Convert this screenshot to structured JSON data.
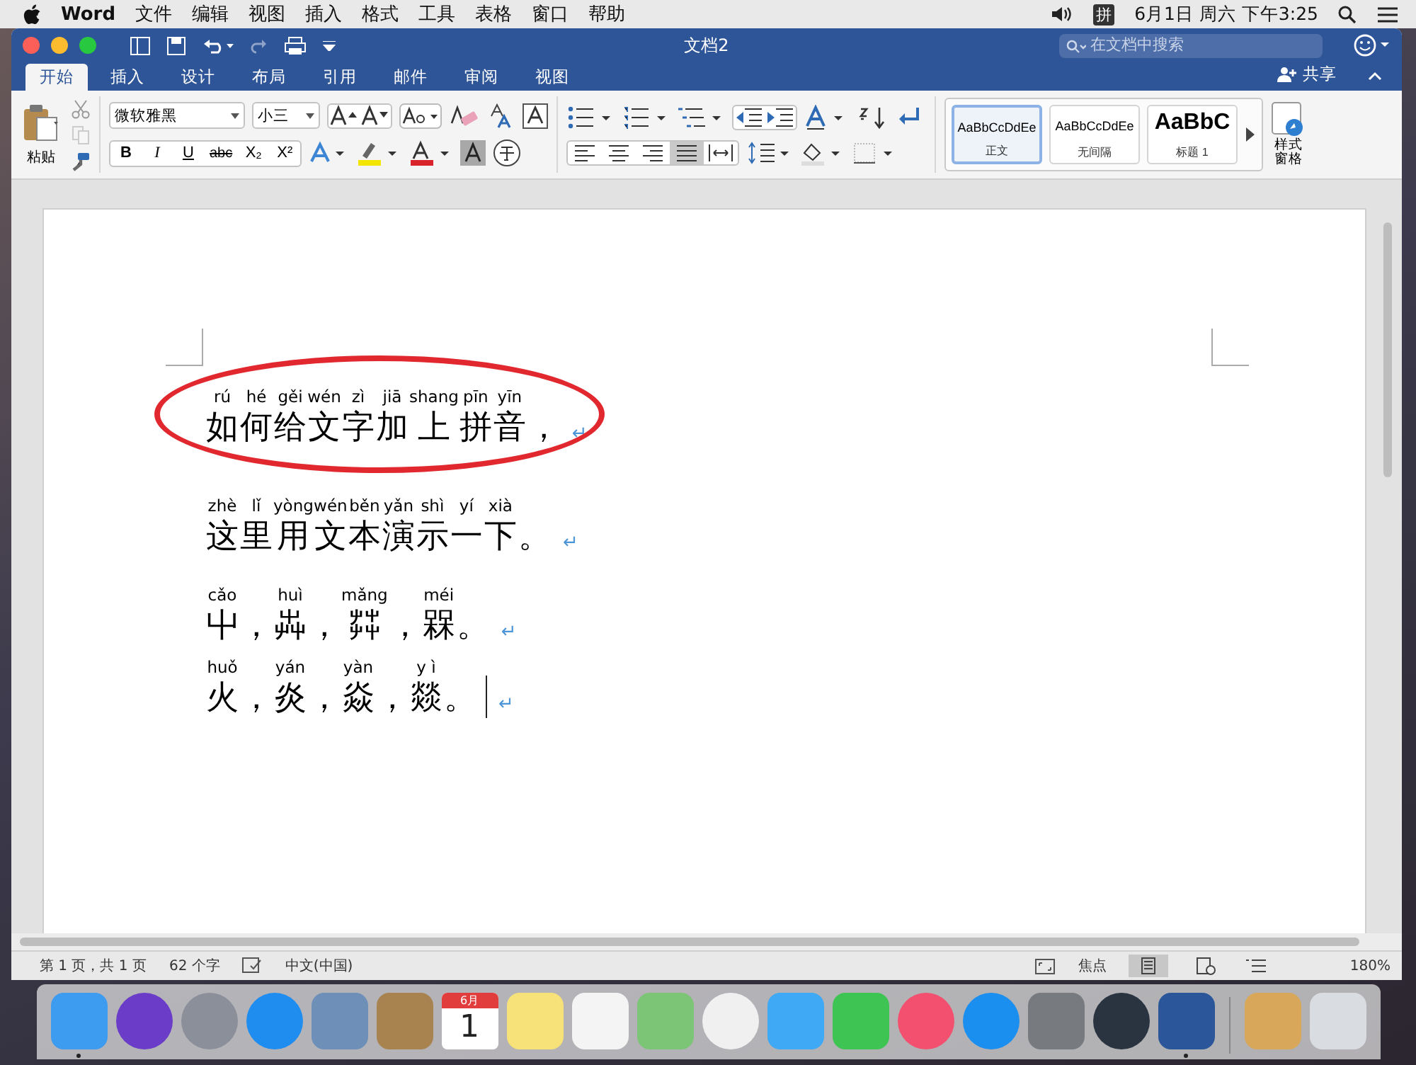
{
  "menu_bar": {
    "app": "Word",
    "menus": [
      "文件",
      "编辑",
      "视图",
      "插入",
      "格式",
      "工具",
      "表格",
      "窗口",
      "帮助"
    ],
    "input_method": "拼",
    "clock": "6月1日 周六 下午3:25"
  },
  "window": {
    "title": "文档2",
    "search": {
      "placeholder": "在文档中搜索"
    }
  },
  "tabs": [
    {
      "label": "开始",
      "selected": true
    },
    {
      "label": "插入",
      "selected": false
    },
    {
      "label": "设计",
      "selected": false
    },
    {
      "label": "布局",
      "selected": false
    },
    {
      "label": "引用",
      "selected": false
    },
    {
      "label": "邮件",
      "selected": false
    },
    {
      "label": "审阅",
      "selected": false
    },
    {
      "label": "视图",
      "selected": false
    }
  ],
  "share": "共享",
  "ribbon": {
    "paste": "粘贴",
    "font": "微软雅黑",
    "size": "小三",
    "format_buttons": [
      "B",
      "I",
      "U",
      "abc",
      "X₂",
      "X²"
    ],
    "styles": [
      {
        "sample": "AaBbCcDdEe",
        "name": "正文",
        "kind": "normal",
        "selected": true
      },
      {
        "sample": "AaBbCcDdEe",
        "name": "无间隔",
        "kind": "normal",
        "selected": false
      },
      {
        "sample": "AaBbC",
        "name": "标题 1",
        "kind": "heading",
        "selected": false
      }
    ],
    "styles_pane": [
      "样式",
      "窗格"
    ]
  },
  "document": {
    "lines": [
      {
        "circled": true,
        "mark": "↵",
        "segments": [
          {
            "pinyin": "rú",
            "text": "如"
          },
          {
            "pinyin": "hé",
            "text": "何"
          },
          {
            "pinyin": "gěi",
            "text": "给"
          },
          {
            "pinyin": "wén",
            "text": "文"
          },
          {
            "pinyin": "zì",
            "text": "字"
          },
          {
            "pinyin": "jiā",
            "text": "加"
          },
          {
            "pinyin": "shang",
            "text": "上"
          },
          {
            "pinyin": "pīn",
            "text": "拼"
          },
          {
            "pinyin": "yīn",
            "text": "音"
          },
          {
            "text": "，"
          }
        ]
      },
      {
        "circled": false,
        "mark": "↵",
        "segments": [
          {
            "pinyin": "zhè",
            "text": "这"
          },
          {
            "pinyin": "lǐ",
            "text": "里"
          },
          {
            "pinyin": "yòng",
            "text": "用"
          },
          {
            "pinyin": "wén",
            "text": "文"
          },
          {
            "pinyin": "běn",
            "text": "本"
          },
          {
            "pinyin": "yǎn",
            "text": "演"
          },
          {
            "pinyin": "shì",
            "text": "示"
          },
          {
            "pinyin": "yí",
            "text": "一"
          },
          {
            "pinyin": "xià",
            "text": "下"
          },
          {
            "text": "。"
          }
        ]
      },
      {
        "circled": false,
        "mark": "↵",
        "segments": [
          {
            "pinyin": "cǎo",
            "text": "屮"
          },
          {
            "text": "，"
          },
          {
            "pinyin": "huì",
            "text": "芔"
          },
          {
            "text": "，"
          },
          {
            "pinyin": "mǎng",
            "text": "茻"
          },
          {
            "text": "，"
          },
          {
            "pinyin": "méi",
            "text": "槑"
          },
          {
            "text": "。"
          }
        ]
      },
      {
        "circled": false,
        "mark": "↵",
        "cursor": true,
        "segments": [
          {
            "pinyin": "huǒ",
            "text": "火"
          },
          {
            "text": "，"
          },
          {
            "pinyin": "yán",
            "text": "炎"
          },
          {
            "text": "，"
          },
          {
            "pinyin": "yàn",
            "text": "焱"
          },
          {
            "text": "，"
          },
          {
            "pinyin": "y ì",
            "text": "燚"
          },
          {
            "text": "。"
          }
        ]
      }
    ]
  },
  "status_bar": {
    "page": "第 1 页，共 1 页",
    "words": "62 个字",
    "language": "中文(中国)",
    "focus": "焦点",
    "zoom": "180%"
  },
  "dock": [
    {
      "kind": "finder",
      "running": true
    },
    {
      "kind": "siri",
      "running": false
    },
    {
      "kind": "launchpad",
      "running": false
    },
    {
      "kind": "safari",
      "running": false
    },
    {
      "kind": "preview",
      "running": false
    },
    {
      "kind": "contacts",
      "running": false
    },
    {
      "kind": "calendar",
      "month": "6月",
      "day": "1",
      "running": false
    },
    {
      "kind": "notes",
      "running": false
    },
    {
      "kind": "reminders",
      "running": false
    },
    {
      "kind": "maps",
      "running": false
    },
    {
      "kind": "photos",
      "running": false
    },
    {
      "kind": "messages",
      "running": false
    },
    {
      "kind": "facetime",
      "running": false
    },
    {
      "kind": "music",
      "running": false
    },
    {
      "kind": "appstore",
      "running": false
    },
    {
      "kind": "settings",
      "running": false
    },
    {
      "kind": "quicktime",
      "running": false
    },
    {
      "kind": "word",
      "running": true
    },
    {
      "kind": "package",
      "running": false
    },
    {
      "kind": "trash",
      "running": false
    }
  ]
}
